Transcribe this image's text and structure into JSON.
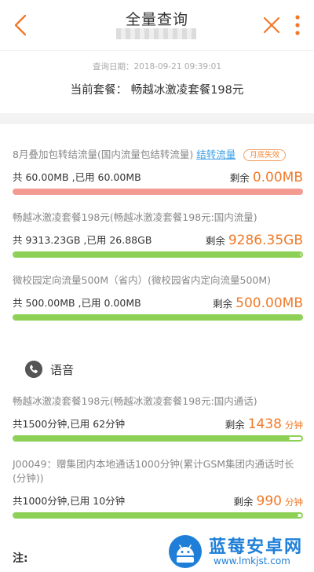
{
  "header": {
    "title": "全量查询"
  },
  "info": {
    "query_date": "查询日期：2018-09-21 09:39:01",
    "package_line": "当前套餐：  畅越冰激凌套餐198元"
  },
  "data_items": [
    {
      "title": "8月叠加包转结流量(国内流量包结转流量)",
      "link": "结转流量",
      "badge": "月底失效",
      "used": "共 60.00MB ,已用 60.00MB",
      "remain_label": "剩余",
      "remain_value": "0.00MB",
      "remain_fraction": 0.0
    },
    {
      "title": "畅越冰激凌套餐198元(畅越冰激凌套餐198元:国内流量)",
      "used": "共 9313.23GB ,已用 26.88GB",
      "remain_label": "剩余",
      "remain_value": "9286.35GB",
      "remain_fraction": 0.997
    },
    {
      "title": "微校园定向流量500M（省内）(微校园省内定向流量500M)",
      "used": "共 500.00MB ,已用 0.00MB",
      "remain_label": "剩余",
      "remain_value": "500.00MB",
      "remain_fraction": 1.0
    }
  ],
  "voice": {
    "section_label": "语音",
    "items": [
      {
        "title": "畅越冰激凌套餐198元(畅越冰激凌套餐198元:国内通话)",
        "used": "共1500分钟,已用 62分钟",
        "remain_label": "剩余",
        "remain_value": "1438",
        "unit": "分钟",
        "remain_fraction": 0.959
      },
      {
        "title": "J00049：赠集团内本地通话1000分钟(累计GSM集团内通话时长(分钟))",
        "used": "共1000分钟,已用 10分钟",
        "remain_label": "剩余",
        "remain_value": "990",
        "unit": "分钟",
        "remain_fraction": 0.99
      }
    ]
  },
  "note": "注:",
  "watermark": {
    "name": "蓝莓安卓网",
    "url": "www.lmkjst.com"
  },
  "colors": {
    "accent": "#f07a2a",
    "link": "#3aa0e8",
    "bar_green": "#8dd056",
    "bar_red": "#f39a91"
  }
}
